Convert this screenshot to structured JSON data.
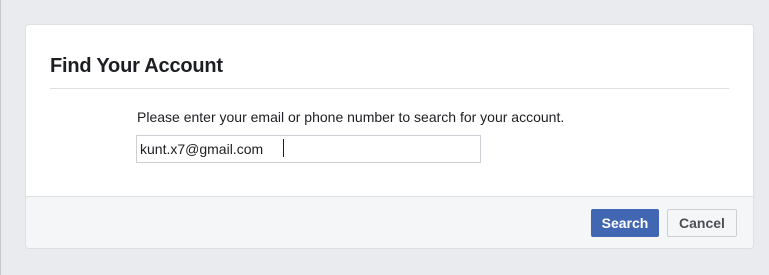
{
  "dialog": {
    "title": "Find Your Account",
    "instructions": "Please enter your email or phone number to search for your account.",
    "email_input": {
      "value": "kunt.x7@gmail.com"
    },
    "buttons": {
      "search_label": "Search",
      "cancel_label": "Cancel"
    }
  },
  "colors": {
    "page_background": "#e9ebee",
    "primary_button": "#4267b2",
    "footer_background": "#f5f6f7",
    "text": "#1c1e21"
  }
}
